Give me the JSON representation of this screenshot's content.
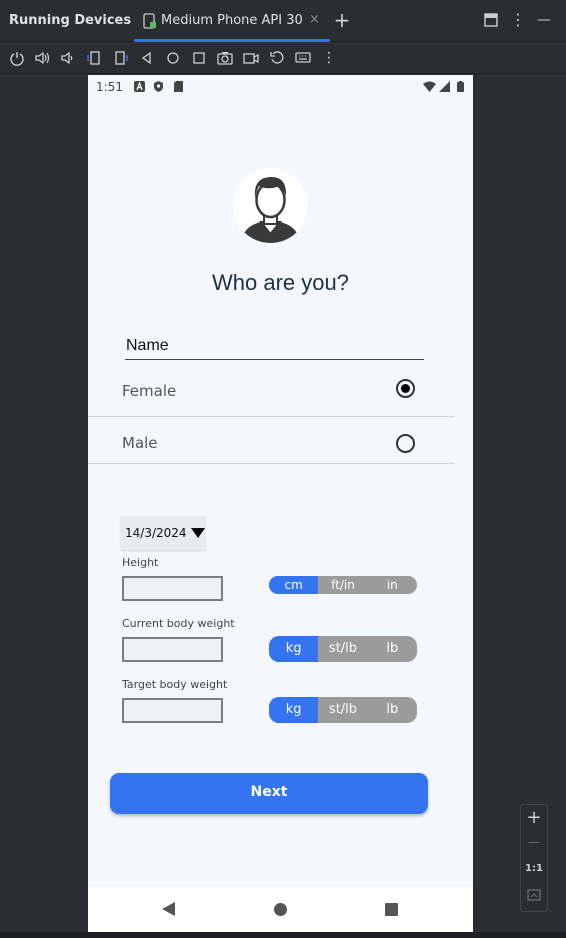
{
  "ide": {
    "panel_title": "Running Devices",
    "tab_label": "Medium Phone API 30",
    "tab_close": "×",
    "add_tab": "+",
    "menu": "⋮",
    "minimize": "—",
    "accent": "#3574f0"
  },
  "zoom": {
    "plus": "+",
    "minus": "—",
    "actual": "1:1"
  },
  "status_bar": {
    "time": "1:51"
  },
  "screen": {
    "heading": "Who are you?",
    "name_placeholder": "Name",
    "gender_options": [
      {
        "label": "Female",
        "selected": true
      },
      {
        "label": "Male",
        "selected": false
      }
    ],
    "date": "14/3/2024",
    "height": {
      "label": "Height",
      "units": [
        "cm",
        "ft/in",
        "in"
      ],
      "selected": "cm"
    },
    "current_weight": {
      "label": "Current body weight",
      "units": [
        "kg",
        "st/lb",
        "lb"
      ],
      "selected": "kg"
    },
    "target_weight": {
      "label": "Target body weight",
      "units": [
        "kg",
        "st/lb",
        "lb"
      ],
      "selected": "kg"
    },
    "next_button": "Next",
    "primary_color": "#3574f0"
  }
}
